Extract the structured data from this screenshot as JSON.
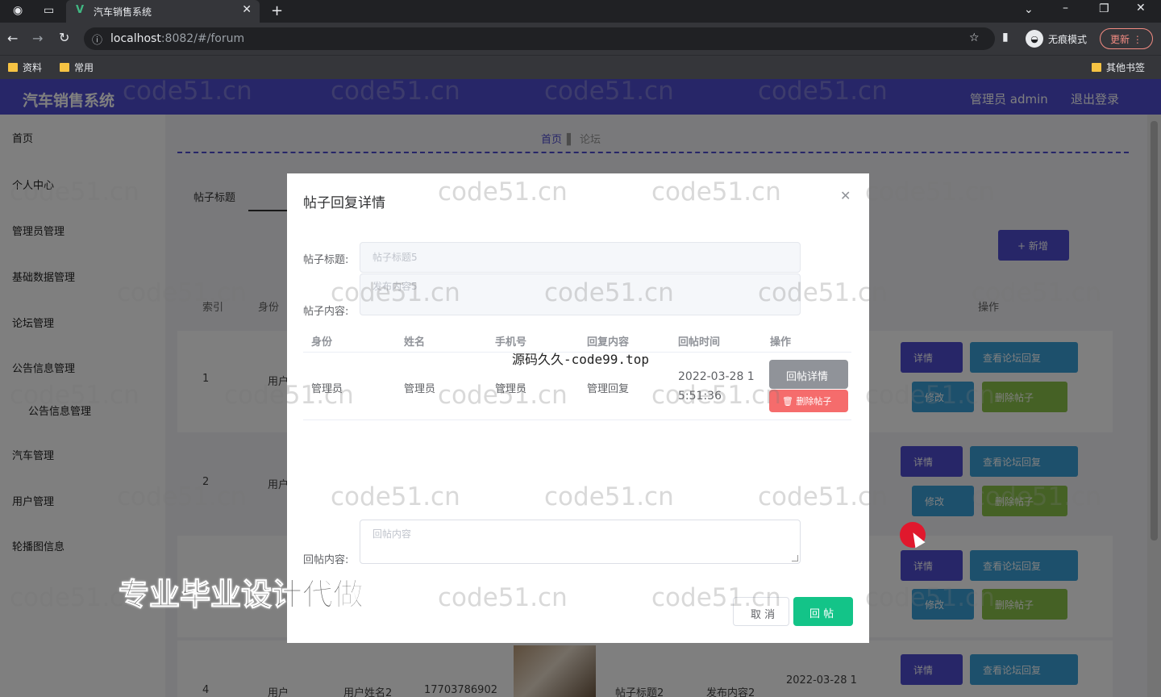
{
  "browser": {
    "tab_title": "汽车销售系统",
    "url_host": "localhost",
    "url_path": ":8082/#/forum",
    "incognito_label": "无痕模式",
    "update_label": "更新",
    "bookmarks": [
      "资料",
      "常用"
    ],
    "other_bookmarks": "其他书签"
  },
  "app": {
    "title": "汽车销售系统",
    "user_label": "管理员 admin",
    "logout_label": "退出登录"
  },
  "sidebar": {
    "items": [
      "首页",
      "个人中心",
      "管理员管理",
      "基础数据管理",
      "论坛管理",
      "公告信息管理",
      "公告信息管理",
      "汽车管理",
      "用户管理",
      "轮播图信息"
    ]
  },
  "main": {
    "breadcrumb": [
      "首页",
      "论坛"
    ],
    "search_label": "帖子标题",
    "add_button": "+ 新增",
    "columns": [
      "索引",
      "身份",
      "操作"
    ],
    "rows": [
      {
        "index": "1",
        "identity": "用户"
      },
      {
        "index": "2",
        "identity": "用户"
      },
      {
        "index": "4",
        "identity": "用户",
        "name": "用户姓名2",
        "phone": "17703786902",
        "title": "帖子标题2",
        "content": "发布内容2",
        "time": "2022-03-28 1"
      }
    ],
    "actions": {
      "detail": "详情",
      "view_replies": "查看论坛回复",
      "edit": "修改",
      "delete": "删除帖子"
    }
  },
  "dialog": {
    "title": "帖子回复详情",
    "title_label": "帖子标题:",
    "title_value": "帖子标题5",
    "content_label": "帖子内容:",
    "content_value": "发布内容5",
    "table_headers": [
      "身份",
      "姓名",
      "手机号",
      "回复内容",
      "回帖时间",
      "操作"
    ],
    "reply_row": {
      "identity": "管理员",
      "name": "管理员",
      "phone": "管理员",
      "content": "管理回复",
      "time_line1": "2022-03-28 1",
      "time_line2": "5:51:36"
    },
    "reply_detail_button": "回帖详情",
    "delete_post_button": "删除帖子",
    "reply_content_label": "回帖内容:",
    "reply_content_placeholder": "回帖内容",
    "cancel_button": "取 消",
    "submit_button": "回 帖",
    "overlay_code": "源码久久-code99.top"
  },
  "overlay_text": {
    "watermark": "code51.cn",
    "promo": "专业毕业设计代做"
  },
  "colors": {
    "brand": "#4e4cd0",
    "accent_green": "#13c488",
    "danger": "#f56c6c"
  }
}
